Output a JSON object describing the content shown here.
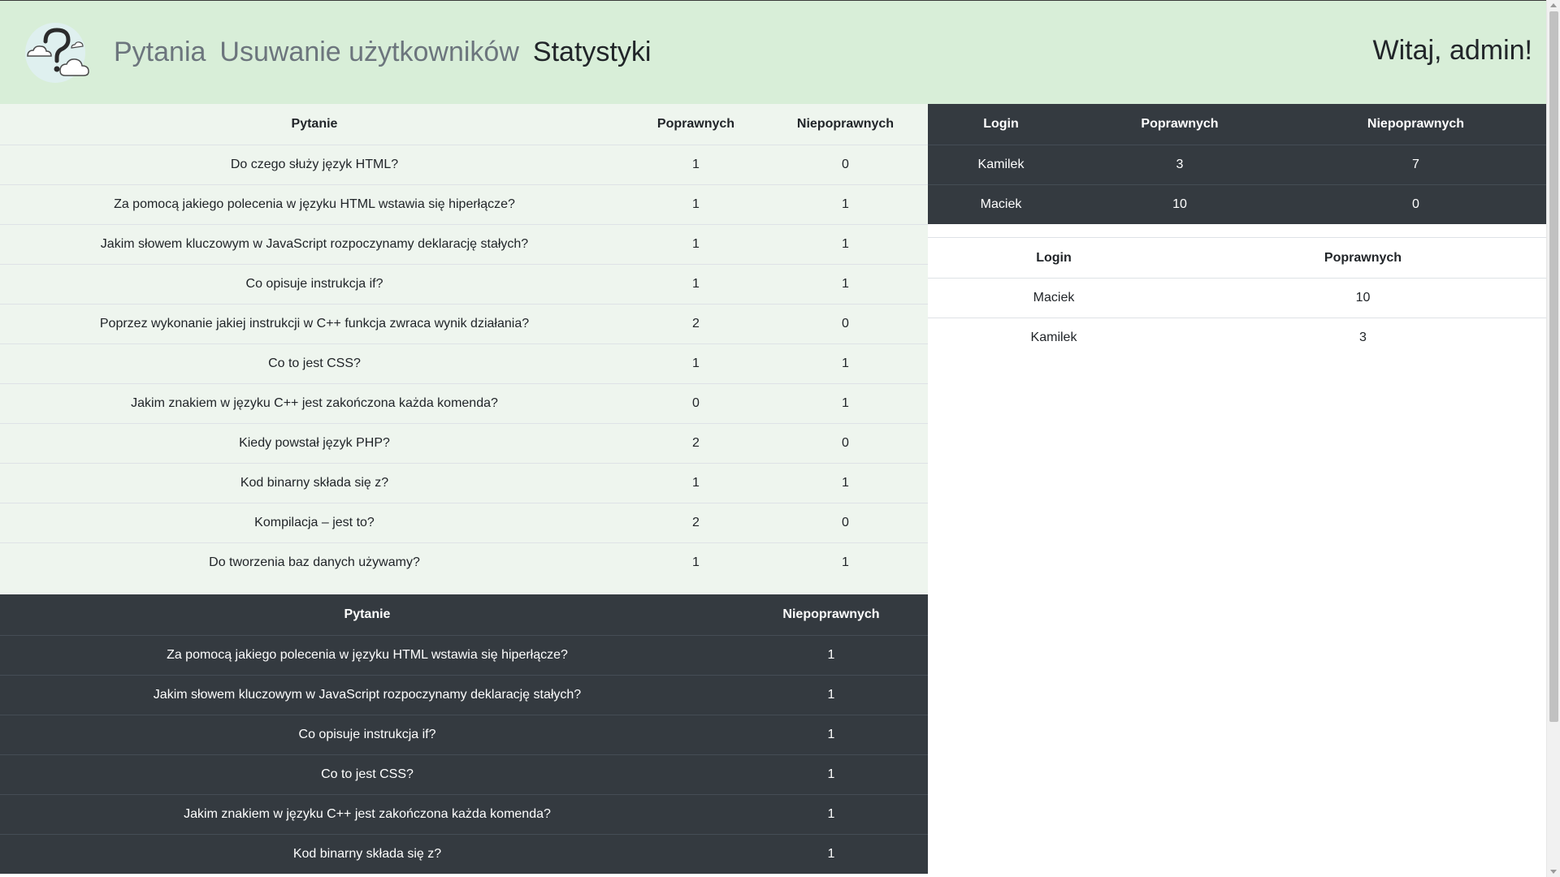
{
  "header": {
    "logo_icon": "question-clouds-icon",
    "nav": [
      {
        "label": "Pytania",
        "active": false
      },
      {
        "label": "Usuwanie użytkowników",
        "active": false
      },
      {
        "label": "Statystyki",
        "active": true
      }
    ],
    "greeting": "Witaj, admin!"
  },
  "question_stats": {
    "headers": [
      "Pytanie",
      "Poprawnych",
      "Niepoprawnych"
    ],
    "rows": [
      [
        "Do czego służy język HTML?",
        "1",
        "0"
      ],
      [
        "Za pomocą jakiego polecenia w języku HTML wstawia się hiperłącze?",
        "1",
        "1"
      ],
      [
        "Jakim słowem kluczowym w JavaScript rozpoczynamy deklarację stałych?",
        "1",
        "1"
      ],
      [
        "Co opisuje instrukcja if?",
        "1",
        "1"
      ],
      [
        "Poprzez wykonanie jakiej instrukcji w C++ funkcja zwraca wynik działania?",
        "2",
        "0"
      ],
      [
        "Co to jest CSS?",
        "1",
        "1"
      ],
      [
        "Jakim znakiem w języku C++ jest zakończona każda komenda?",
        "0",
        "1"
      ],
      [
        "Kiedy powstał język PHP?",
        "2",
        "0"
      ],
      [
        "Kod binarny składa się z?",
        "1",
        "1"
      ],
      [
        "Kompilacja – jest to?",
        "2",
        "0"
      ],
      [
        "Do tworzenia baz danych używamy?",
        "1",
        "1"
      ]
    ]
  },
  "wrong_questions": {
    "headers": [
      "Pytanie",
      "Niepoprawnych"
    ],
    "rows": [
      [
        "Za pomocą jakiego polecenia w języku HTML wstawia się hiperłącze?",
        "1"
      ],
      [
        "Jakim słowem kluczowym w JavaScript rozpoczynamy deklarację stałych?",
        "1"
      ],
      [
        "Co opisuje instrukcja if?",
        "1"
      ],
      [
        "Co to jest CSS?",
        "1"
      ],
      [
        "Jakim znakiem w języku C++ jest zakończona każda komenda?",
        "1"
      ],
      [
        "Kod binarny składa się z?",
        "1"
      ]
    ]
  },
  "user_stats": {
    "headers": [
      "Login",
      "Poprawnych",
      "Niepoprawnych"
    ],
    "rows": [
      [
        "Kamilek",
        "3",
        "7"
      ],
      [
        "Maciek",
        "10",
        "0"
      ]
    ]
  },
  "ranking": {
    "headers": [
      "Login",
      "Poprawnych"
    ],
    "rows": [
      [
        "Maciek",
        "10"
      ],
      [
        "Kamilek",
        "3"
      ]
    ]
  },
  "colors": {
    "header_bg": "#d8eed8",
    "light_table_bg": "#eef5ee",
    "dark_table_bg": "#343a40"
  }
}
